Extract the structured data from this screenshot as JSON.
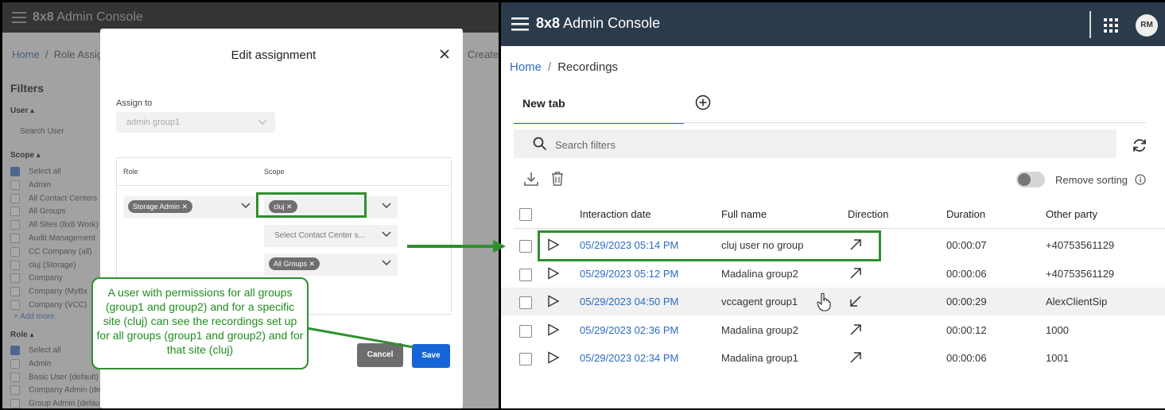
{
  "background_app": {
    "brand_bold": "8x8",
    "brand_rest": "Admin Console",
    "breadcrumb_home": "Home",
    "breadcrumb_current": "Role Assig",
    "create_text": "Create",
    "filters_title": "Filters",
    "user_section": "User",
    "search_user_placeholder": "Search User",
    "scope_section": "Scope",
    "scope_items": [
      {
        "label": "Select all",
        "checked": true
      },
      {
        "label": "Admin",
        "checked": false
      },
      {
        "label": "All Contact Centers",
        "checked": false
      },
      {
        "label": "All Groups",
        "checked": false
      },
      {
        "label": "All Sites (8x8 Work)",
        "checked": false
      },
      {
        "label": "Audit Management",
        "checked": false
      },
      {
        "label": "CC Company (all)",
        "checked": false
      },
      {
        "label": "cluj (Storage)",
        "checked": false
      },
      {
        "label": "Company",
        "checked": false
      },
      {
        "label": "Company (MyBx",
        "checked": false
      },
      {
        "label": "Company (VCC)",
        "checked": false
      }
    ],
    "add_more": "+ Add more",
    "role_section": "Role",
    "role_items": [
      {
        "label": "Select all",
        "checked": true
      },
      {
        "label": "Admin",
        "checked": false
      },
      {
        "label": "Basic User (default)",
        "checked": false
      },
      {
        "label": "Company Admin (defa",
        "checked": false
      },
      {
        "label": "Group Admin (default)",
        "checked": false
      }
    ]
  },
  "modal": {
    "title": "Edit assignment",
    "assign_to_label": "Assign to",
    "assign_to_value": "admin group1",
    "col_role": "Role",
    "col_scope": "Scope",
    "role_chip": "Storage Admin",
    "scope_chip": "cluj",
    "contact_center_placeholder": "Select Contact Center s...",
    "groups_chip": "All Groups",
    "cancel_label": "Cancel",
    "save_label": "Save"
  },
  "annotation": {
    "text": "A user with permissions for all groups (group1 and group2) and for a  specific site (cluj) can see the recordings set up for all groups (group1 and group2) and for that site (cluj)",
    "color": "#2f8f2f"
  },
  "app": {
    "brand_bold": "8x8",
    "brand_rest": "Admin Console",
    "avatar_initials": "RM",
    "topbar_color": "#2b3b4c",
    "accent": "#2a6cc4",
    "breadcrumb_home": "Home",
    "breadcrumb_current": "Recordings",
    "tab_label": "New tab",
    "search_placeholder": "Search filters",
    "remove_sorting_label": "Remove sorting",
    "columns": [
      "Interaction date",
      "Full name",
      "Direction",
      "Duration",
      "Other party"
    ],
    "rows": [
      {
        "date": "05/29/2023 05:14 PM",
        "name": "cluj user no group",
        "direction": "outgoing",
        "duration": "00:00:07",
        "other": "+40753561129"
      },
      {
        "date": "05/29/2023 05:12 PM",
        "name": "Madalina group2",
        "direction": "outgoing",
        "duration": "00:00:06",
        "other": "+40753561129"
      },
      {
        "date": "05/29/2023 04:50 PM",
        "name": "vccagent group1",
        "direction": "incoming",
        "duration": "00:00:29",
        "other": "AlexClientSip"
      },
      {
        "date": "05/29/2023 02:36 PM",
        "name": "Madalina group2",
        "direction": "outgoing",
        "duration": "00:00:12",
        "other": "1000"
      },
      {
        "date": "05/29/2023 02:34 PM",
        "name": "Madalina group1",
        "direction": "outgoing",
        "duration": "00:00:06",
        "other": "1001"
      }
    ]
  }
}
